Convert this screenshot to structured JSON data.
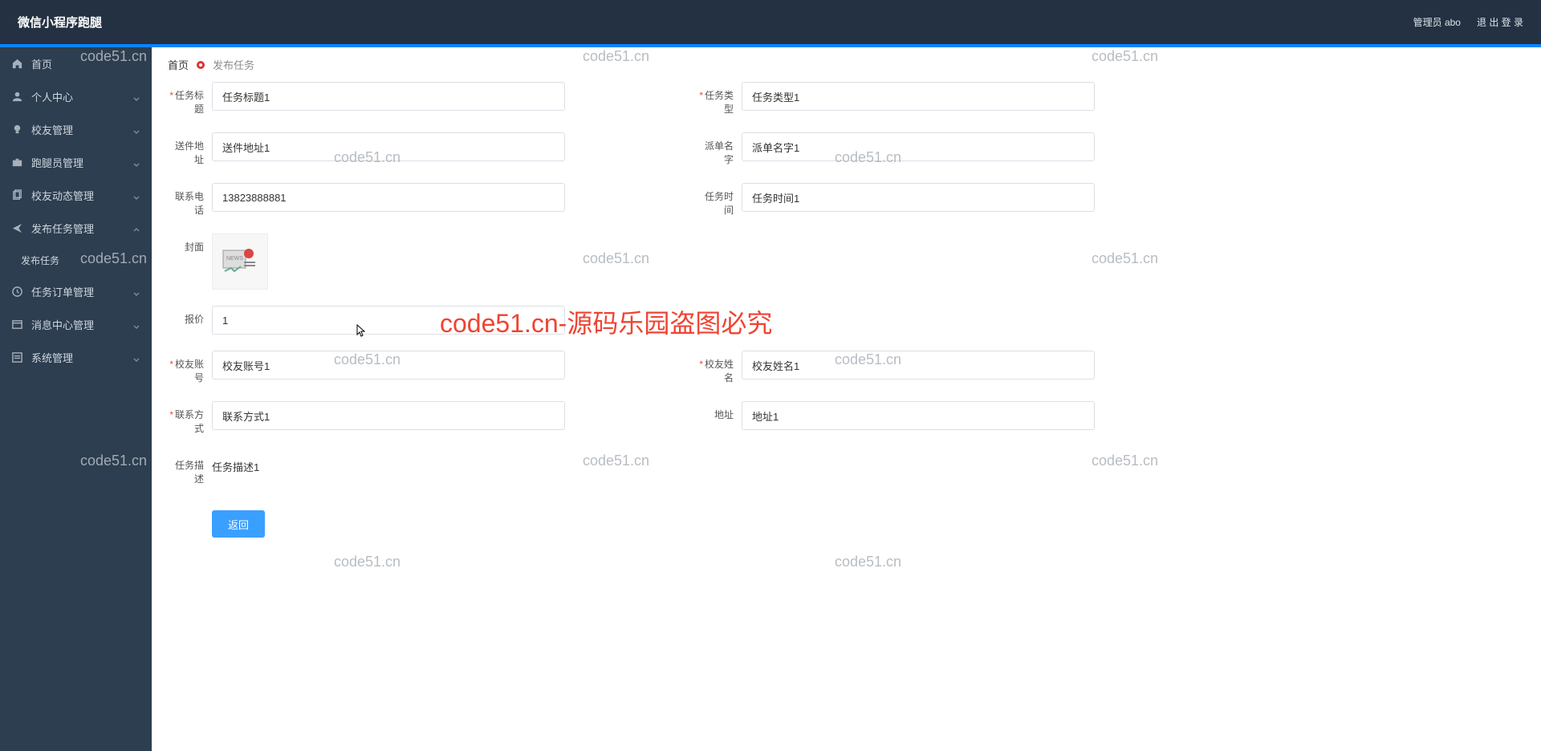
{
  "header": {
    "title": "微信小程序跑腿",
    "admin_label": "管理员 abo",
    "logout_label": "退 出 登 录"
  },
  "sidebar": {
    "items": [
      {
        "icon": "home",
        "label": "首页",
        "expandable": false
      },
      {
        "icon": "user",
        "label": "个人中心",
        "expandable": true
      },
      {
        "icon": "bulb",
        "label": "校友管理",
        "expandable": true
      },
      {
        "icon": "case",
        "label": "跑腿员管理",
        "expandable": true
      },
      {
        "icon": "copy",
        "label": "校友动态管理",
        "expandable": true
      },
      {
        "icon": "send",
        "label": "发布任务管理",
        "expandable": true,
        "expanded": true,
        "children": [
          {
            "label": "发布任务"
          }
        ]
      },
      {
        "icon": "clock",
        "label": "任务订单管理",
        "expandable": true
      },
      {
        "icon": "window",
        "label": "消息中心管理",
        "expandable": true
      },
      {
        "icon": "list",
        "label": "系统管理",
        "expandable": true
      }
    ]
  },
  "breadcrumb": {
    "home": "首页",
    "current": "发布任务"
  },
  "form": {
    "task_title": {
      "label": "任务标题",
      "value": "任务标题1",
      "required": true
    },
    "task_type": {
      "label": "任务类型",
      "value": "任务类型1",
      "required": true
    },
    "delivery_addr": {
      "label": "送件地址",
      "value": "送件地址1",
      "required": false
    },
    "dispatcher_name": {
      "label": "派单名字",
      "value": "派单名字1",
      "required": false
    },
    "contact_phone": {
      "label": "联系电话",
      "value": "13823888881",
      "required": false
    },
    "task_time": {
      "label": "任务时间",
      "value": "任务时间1",
      "required": false
    },
    "cover": {
      "label": "封面"
    },
    "price": {
      "label": "报价",
      "value": "1",
      "required": false
    },
    "alumni_account": {
      "label": "校友账号",
      "value": "校友账号1",
      "required": true
    },
    "alumni_name": {
      "label": "校友姓名",
      "value": "校友姓名1",
      "required": true
    },
    "contact_way": {
      "label": "联系方式",
      "value": "联系方式1",
      "required": true
    },
    "address": {
      "label": "地址",
      "value": "地址1",
      "required": false
    },
    "task_desc": {
      "label": "任务描述",
      "value": "任务描述1"
    }
  },
  "buttons": {
    "back": "返回"
  },
  "watermark": {
    "small": "code51.cn",
    "big": "code51.cn-源码乐园盗图必究"
  }
}
